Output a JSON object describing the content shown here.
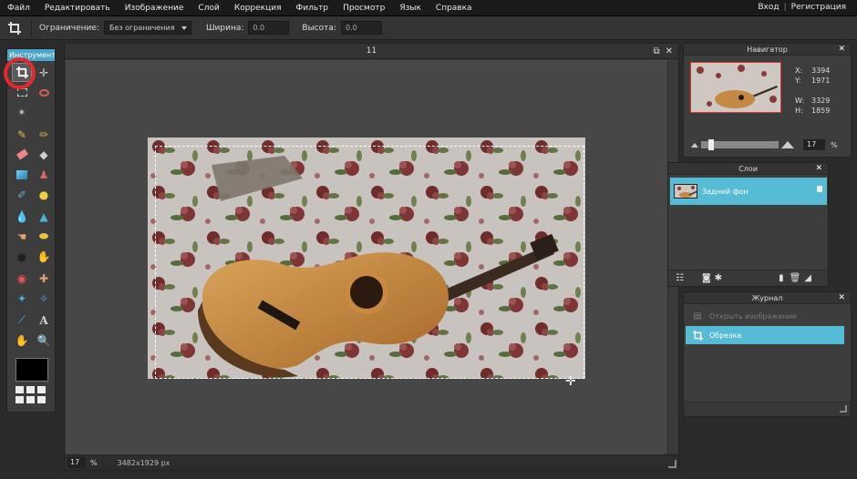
{
  "menu": {
    "items": [
      "Файл",
      "Редактировать",
      "Изображение",
      "Слой",
      "Коррекция",
      "Фильтр",
      "Просмотр",
      "Язык",
      "Справка"
    ],
    "login": "Вход",
    "separator": "|",
    "register": "Регистрация"
  },
  "options": {
    "constraint_label": "Ограничение:",
    "constraint_value": "Без ограничения",
    "width_label": "Ширина:",
    "width_value": "0.0",
    "height_label": "Высота:",
    "height_value": "0.0"
  },
  "tools": {
    "title": "Инструменты",
    "icons": [
      "crop-icon",
      "move-icon",
      "marquee-icon",
      "lasso-icon",
      "magic-wand-icon",
      "pencil-icon",
      "brush-icon",
      "eraser-icon",
      "bucket-icon",
      "gradient-icon",
      "clone-stamp-icon",
      "color-replace-icon",
      "drawing-icon",
      "blur-icon",
      "sharpen-icon",
      "smudge-icon",
      "sponge-icon",
      "dodge-icon",
      "burn-icon",
      "red-eye-icon",
      "spot-heal-icon",
      "bloat-icon",
      "pinch-icon",
      "color-picker-icon",
      "type-icon",
      "hand-icon",
      "zoom-icon"
    ],
    "foreground_color": "#000000"
  },
  "document": {
    "title": "11",
    "zoom": "17",
    "zoom_unit": "%",
    "dimensions": "3482x1929 px"
  },
  "navigator": {
    "title": "Навигатор",
    "x_label": "X:",
    "x_value": "3394",
    "y_label": "Y:",
    "y_value": "1971",
    "w_label": "W:",
    "w_value": "3329",
    "h_label": "H:",
    "h_value": "1859",
    "zoom": "17",
    "zoom_unit": "%"
  },
  "layers": {
    "title": "Слои",
    "items": [
      {
        "name": "Задний фон"
      }
    ]
  },
  "history": {
    "title": "Журнал",
    "items": [
      {
        "label": "Открыть изображение",
        "state": "dim"
      },
      {
        "label": "Обрезка",
        "state": "selected"
      }
    ]
  },
  "colors": {
    "accent": "#56bbd4",
    "highlight_circle": "#e4282c"
  }
}
